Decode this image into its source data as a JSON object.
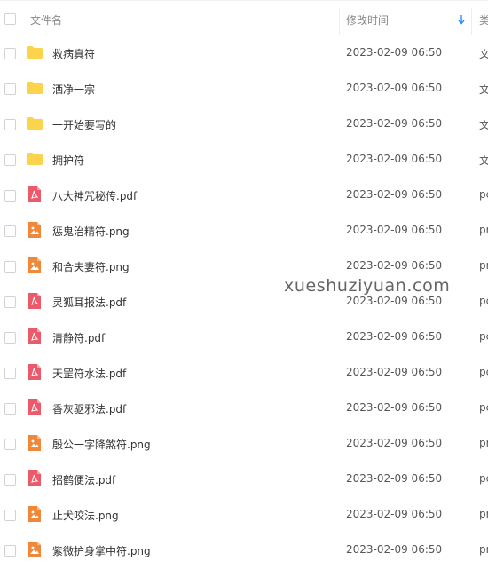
{
  "header": {
    "name_label": "文件名",
    "time_label": "修改时间",
    "type_label": "类",
    "sort_icon": "sort-down-arrow-icon",
    "accent_color": "#2b8cff"
  },
  "files": [
    {
      "name": "救病真符",
      "time": "2023-02-09 06:50",
      "type": "文",
      "icon": "folder-icon"
    },
    {
      "name": "洒净一宗",
      "time": "2023-02-09 06:50",
      "type": "文",
      "icon": "folder-icon"
    },
    {
      "name": "一开始要写的",
      "time": "2023-02-09 06:50",
      "type": "文",
      "icon": "folder-icon"
    },
    {
      "name": "拥护符",
      "time": "2023-02-09 06:50",
      "type": "文",
      "icon": "folder-icon"
    },
    {
      "name": "八大神咒秘传.pdf",
      "time": "2023-02-09 06:50",
      "type": "pc",
      "icon": "pdf-icon"
    },
    {
      "name": "惩鬼治精符.png",
      "time": "2023-02-09 06:50",
      "type": "pr",
      "icon": "image-icon"
    },
    {
      "name": "和合夫妻符.png",
      "time": "2023-02-09 06:50",
      "type": "pr",
      "icon": "image-icon"
    },
    {
      "name": "灵狐耳报法.pdf",
      "time": "2023-02-09 06:50",
      "type": "pc",
      "icon": "pdf-icon"
    },
    {
      "name": "清静符.pdf",
      "time": "2023-02-09 06:50",
      "type": "pc",
      "icon": "pdf-icon"
    },
    {
      "name": "天罡符水法.pdf",
      "time": "2023-02-09 06:50",
      "type": "pc",
      "icon": "pdf-icon"
    },
    {
      "name": "香灰驱邪法.pdf",
      "time": "2023-02-09 06:50",
      "type": "pc",
      "icon": "pdf-icon"
    },
    {
      "name": "殷公一字降煞符.png",
      "time": "2023-02-09 06:50",
      "type": "pr",
      "icon": "image-icon"
    },
    {
      "name": "招鹤便法.pdf",
      "time": "2023-02-09 06:50",
      "type": "pc",
      "icon": "pdf-icon"
    },
    {
      "name": "止犬咬法.png",
      "time": "2023-02-09 06:50",
      "type": "pr",
      "icon": "image-icon"
    },
    {
      "name": "紫微护身掌中符.png",
      "time": "2023-02-09 06:50",
      "type": "pr",
      "icon": "image-icon"
    }
  ],
  "icon_colors": {
    "folder": "#fcd34d",
    "pdf": "#ea5a6a",
    "image": "#f0883a"
  },
  "watermark": "xueshuziyuan.com"
}
